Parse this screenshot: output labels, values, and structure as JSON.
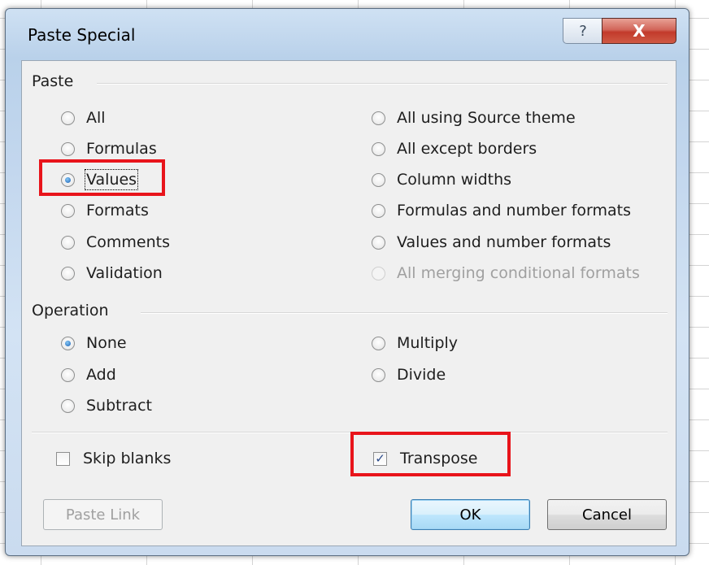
{
  "dialog": {
    "title": "Paste Special",
    "help_glyph": "?",
    "close_glyph": "X"
  },
  "paste": {
    "label": "Paste",
    "left": [
      {
        "label": "All",
        "selected": false
      },
      {
        "label": "Formulas",
        "selected": false
      },
      {
        "label": "Values",
        "selected": true
      },
      {
        "label": "Formats",
        "selected": false
      },
      {
        "label": "Comments",
        "selected": false
      },
      {
        "label": "Validation",
        "selected": false
      }
    ],
    "right": [
      {
        "label": "All using Source theme",
        "selected": false
      },
      {
        "label": "All except borders",
        "selected": false
      },
      {
        "label": "Column widths",
        "selected": false
      },
      {
        "label": "Formulas and number formats",
        "selected": false
      },
      {
        "label": "Values and number formats",
        "selected": false
      },
      {
        "label": "All merging conditional formats",
        "selected": false,
        "disabled": true
      }
    ]
  },
  "operation": {
    "label": "Operation",
    "left": [
      {
        "label": "None",
        "selected": true
      },
      {
        "label": "Add",
        "selected": false
      },
      {
        "label": "Subtract",
        "selected": false
      }
    ],
    "right": [
      {
        "label": "Multiply",
        "selected": false
      },
      {
        "label": "Divide",
        "selected": false
      }
    ]
  },
  "checks": {
    "skip_blanks": {
      "label": "Skip blanks",
      "checked": false
    },
    "transpose": {
      "label": "Transpose",
      "checked": true
    }
  },
  "buttons": {
    "paste_link": "Paste Link",
    "ok": "OK",
    "cancel": "Cancel"
  },
  "colors": {
    "highlight": "#e8141b",
    "accent": "#1a5fb4"
  }
}
